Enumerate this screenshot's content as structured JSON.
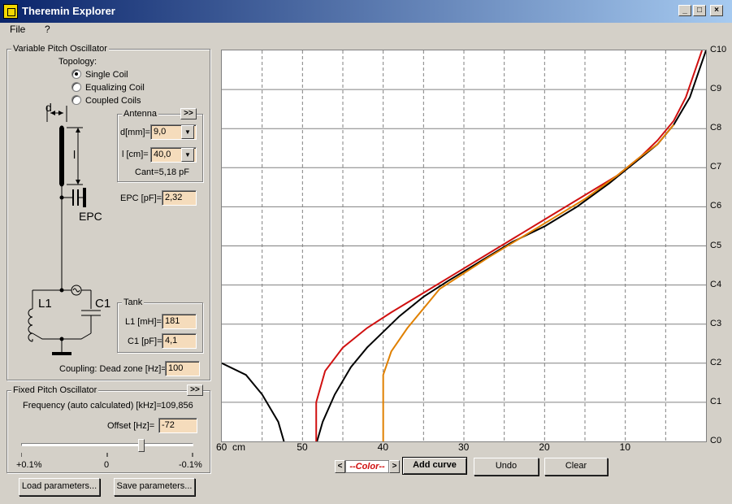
{
  "window": {
    "title": "Theremin Explorer",
    "min": "_",
    "max": "□",
    "close": "×"
  },
  "menu": [
    "File",
    "?"
  ],
  "vpo": {
    "title": "Variable Pitch Oscillator",
    "topology_label": "Topology:",
    "topologies": [
      {
        "label": "Single Coil",
        "selected": true
      },
      {
        "label": "Equalizing Coil",
        "selected": false
      },
      {
        "label": "Coupled Coils",
        "selected": false
      }
    ],
    "diagram": {
      "d": "d",
      "l": "l",
      "epc": "EPC",
      "l1": "L1",
      "c1": "C1"
    },
    "antenna": {
      "title": "Antenna",
      "expand": ">>",
      "d_label": "d[mm]=",
      "d_value": "9,0",
      "l_label": "l [cm]=",
      "l_value": "40,0",
      "cant": "Cant=5,18 pF"
    },
    "epc_label": "EPC [pF]=",
    "epc_value": "2,32",
    "tank": {
      "title": "Tank",
      "l1_label": "L1 [mH]=",
      "l1_value": "181",
      "c1_label": "C1 [pF]=",
      "c1_value": "4,1"
    },
    "coupling_label": "Coupling: Dead zone [Hz]=",
    "coupling_value": "100"
  },
  "fpo": {
    "title": "Fixed Pitch Oscillator",
    "expand": ">>",
    "freq_label": "Frequency (auto calculated) [kHz]=",
    "freq_value": "109,856",
    "offset_label": "Offset [Hz]=",
    "offset_value": "-72",
    "slider": {
      "min_label": "+0.1%",
      "mid_label": "0",
      "max_label": "-0.1%",
      "position": 0.7
    }
  },
  "buttons": {
    "load": "Load parameters...",
    "save": "Save parameters...",
    "color_prev": "<",
    "color": "--Color--",
    "color_next": ">",
    "add_curve": "Add curve",
    "undo": "Undo",
    "clear": "Clear"
  },
  "colors": {
    "red": "#d01010",
    "black": "#000000",
    "orange": "#e08000",
    "field": "#f5dcbc"
  },
  "chart_data": {
    "type": "line",
    "x_unit": "cm",
    "x_ticks": [
      "60",
      "50",
      "40",
      "30",
      "20",
      "10"
    ],
    "y_ticks": [
      "C0",
      "C1",
      "C2",
      "C3",
      "C4",
      "C5",
      "C6",
      "C7",
      "C8",
      "C9",
      "C10"
    ],
    "xlim": [
      60,
      0
    ],
    "ylim": [
      0,
      10
    ],
    "grid": true,
    "series": [
      {
        "color": "#000000",
        "points": [
          [
            60,
            2.0
          ],
          [
            57,
            1.7
          ],
          [
            55,
            1.2
          ],
          [
            53,
            0.5
          ],
          [
            52.3,
            0
          ]
        ]
      },
      {
        "color": "#000000",
        "points": [
          [
            48.2,
            0
          ],
          [
            47.5,
            0.5
          ],
          [
            46,
            1.2
          ],
          [
            44,
            1.9
          ],
          [
            42,
            2.4
          ],
          [
            40,
            2.8
          ],
          [
            38,
            3.2
          ],
          [
            35,
            3.7
          ],
          [
            32,
            4.1
          ],
          [
            28,
            4.6
          ],
          [
            24,
            5.1
          ],
          [
            20,
            5.5
          ],
          [
            16,
            6.0
          ],
          [
            12,
            6.6
          ],
          [
            9,
            7.1
          ],
          [
            6,
            7.6
          ],
          [
            4,
            8.1
          ],
          [
            2,
            8.8
          ],
          [
            1,
            9.4
          ],
          [
            0,
            10
          ]
        ]
      },
      {
        "color": "#d01010",
        "points": [
          [
            48.3,
            0
          ],
          [
            48.3,
            1.0
          ],
          [
            47.2,
            1.8
          ],
          [
            45,
            2.4
          ],
          [
            42,
            2.9
          ],
          [
            39,
            3.3
          ],
          [
            35,
            3.8
          ],
          [
            31,
            4.3
          ],
          [
            27,
            4.8
          ],
          [
            23,
            5.3
          ],
          [
            19,
            5.8
          ],
          [
            15,
            6.3
          ],
          [
            11,
            6.8
          ],
          [
            8,
            7.3
          ],
          [
            6,
            7.7
          ],
          [
            4,
            8.2
          ],
          [
            2.5,
            8.8
          ],
          [
            1.5,
            9.4
          ],
          [
            0.5,
            10
          ]
        ]
      },
      {
        "color": "#e08000",
        "points": [
          [
            40,
            0
          ],
          [
            40,
            1.7
          ],
          [
            39,
            2.3
          ],
          [
            37,
            2.9
          ],
          [
            35,
            3.4
          ],
          [
            33,
            3.9
          ],
          [
            30,
            4.3
          ],
          [
            27,
            4.7
          ],
          [
            23,
            5.2
          ],
          [
            19,
            5.7
          ],
          [
            15,
            6.2
          ],
          [
            11,
            6.8
          ],
          [
            8,
            7.3
          ],
          [
            6,
            7.6
          ],
          [
            4,
            8.1
          ]
        ]
      }
    ]
  }
}
